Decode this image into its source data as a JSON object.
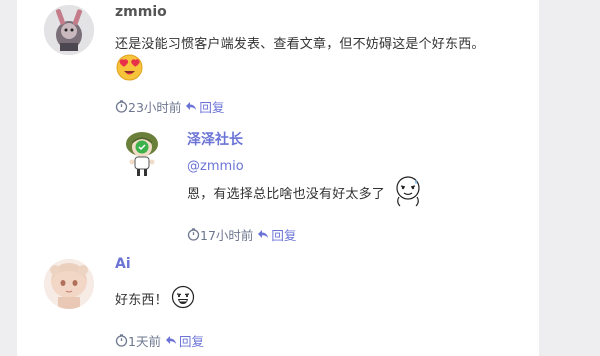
{
  "comments": [
    {
      "username": "zmmio",
      "text": "还是没能习惯客户端发表、查看文章，但不妨碍这是个好东西。",
      "emoji": "heart-eyes-emoji",
      "time": "23小时前",
      "reply_label": "回复"
    },
    {
      "username": "泽泽社长",
      "mention": "@zmmio",
      "text": "恩，有选择总比啥也没有好太多了",
      "emoji": "sweating-face-emoji",
      "time": "17小时前",
      "reply_label": "回复"
    },
    {
      "username": "Ai",
      "text": "好东西！",
      "emoji": "grinning-face-emoji",
      "time": "1天前",
      "reply_label": "回复"
    }
  ],
  "icons": {
    "clock": "clock-icon",
    "reply": "reply-arrow-icon"
  },
  "colors": {
    "accent": "#6b74d6",
    "meta": "#6e7790",
    "text": "#333333",
    "username": "#555555",
    "heart": "#e8304a",
    "emoji_yellow": "#f6c33a"
  }
}
